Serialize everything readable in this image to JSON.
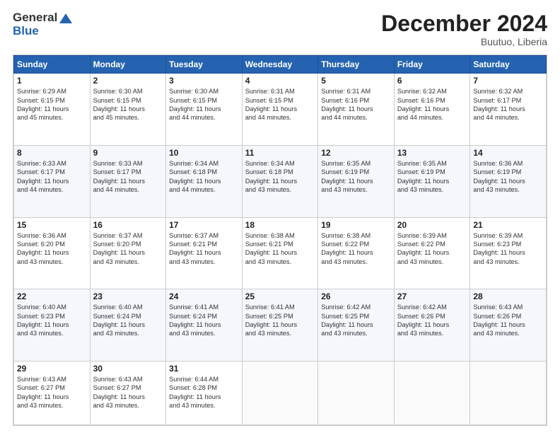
{
  "header": {
    "logo_line1": "General",
    "logo_line2": "Blue",
    "month": "December 2024",
    "location": "Buutuo, Liberia"
  },
  "weekdays": [
    "Sunday",
    "Monday",
    "Tuesday",
    "Wednesday",
    "Thursday",
    "Friday",
    "Saturday"
  ],
  "weeks": [
    [
      {
        "day": "1",
        "sunrise": "6:29 AM",
        "sunset": "6:15 PM",
        "daylight": "11 hours and 45 minutes."
      },
      {
        "day": "2",
        "sunrise": "6:30 AM",
        "sunset": "6:15 PM",
        "daylight": "11 hours and 45 minutes."
      },
      {
        "day": "3",
        "sunrise": "6:30 AM",
        "sunset": "6:15 PM",
        "daylight": "11 hours and 44 minutes."
      },
      {
        "day": "4",
        "sunrise": "6:31 AM",
        "sunset": "6:15 PM",
        "daylight": "11 hours and 44 minutes."
      },
      {
        "day": "5",
        "sunrise": "6:31 AM",
        "sunset": "6:16 PM",
        "daylight": "11 hours and 44 minutes."
      },
      {
        "day": "6",
        "sunrise": "6:32 AM",
        "sunset": "6:16 PM",
        "daylight": "11 hours and 44 minutes."
      },
      {
        "day": "7",
        "sunrise": "6:32 AM",
        "sunset": "6:17 PM",
        "daylight": "11 hours and 44 minutes."
      }
    ],
    [
      {
        "day": "8",
        "sunrise": "6:33 AM",
        "sunset": "6:17 PM",
        "daylight": "11 hours and 44 minutes."
      },
      {
        "day": "9",
        "sunrise": "6:33 AM",
        "sunset": "6:17 PM",
        "daylight": "11 hours and 44 minutes."
      },
      {
        "day": "10",
        "sunrise": "6:34 AM",
        "sunset": "6:18 PM",
        "daylight": "11 hours and 44 minutes."
      },
      {
        "day": "11",
        "sunrise": "6:34 AM",
        "sunset": "6:18 PM",
        "daylight": "11 hours and 43 minutes."
      },
      {
        "day": "12",
        "sunrise": "6:35 AM",
        "sunset": "6:19 PM",
        "daylight": "11 hours and 43 minutes."
      },
      {
        "day": "13",
        "sunrise": "6:35 AM",
        "sunset": "6:19 PM",
        "daylight": "11 hours and 43 minutes."
      },
      {
        "day": "14",
        "sunrise": "6:36 AM",
        "sunset": "6:19 PM",
        "daylight": "11 hours and 43 minutes."
      }
    ],
    [
      {
        "day": "15",
        "sunrise": "6:36 AM",
        "sunset": "6:20 PM",
        "daylight": "11 hours and 43 minutes."
      },
      {
        "day": "16",
        "sunrise": "6:37 AM",
        "sunset": "6:20 PM",
        "daylight": "11 hours and 43 minutes."
      },
      {
        "day": "17",
        "sunrise": "6:37 AM",
        "sunset": "6:21 PM",
        "daylight": "11 hours and 43 minutes."
      },
      {
        "day": "18",
        "sunrise": "6:38 AM",
        "sunset": "6:21 PM",
        "daylight": "11 hours and 43 minutes."
      },
      {
        "day": "19",
        "sunrise": "6:38 AM",
        "sunset": "6:22 PM",
        "daylight": "11 hours and 43 minutes."
      },
      {
        "day": "20",
        "sunrise": "6:39 AM",
        "sunset": "6:22 PM",
        "daylight": "11 hours and 43 minutes."
      },
      {
        "day": "21",
        "sunrise": "6:39 AM",
        "sunset": "6:23 PM",
        "daylight": "11 hours and 43 minutes."
      }
    ],
    [
      {
        "day": "22",
        "sunrise": "6:40 AM",
        "sunset": "6:23 PM",
        "daylight": "11 hours and 43 minutes."
      },
      {
        "day": "23",
        "sunrise": "6:40 AM",
        "sunset": "6:24 PM",
        "daylight": "11 hours and 43 minutes."
      },
      {
        "day": "24",
        "sunrise": "6:41 AM",
        "sunset": "6:24 PM",
        "daylight": "11 hours and 43 minutes."
      },
      {
        "day": "25",
        "sunrise": "6:41 AM",
        "sunset": "6:25 PM",
        "daylight": "11 hours and 43 minutes."
      },
      {
        "day": "26",
        "sunrise": "6:42 AM",
        "sunset": "6:25 PM",
        "daylight": "11 hours and 43 minutes."
      },
      {
        "day": "27",
        "sunrise": "6:42 AM",
        "sunset": "6:26 PM",
        "daylight": "11 hours and 43 minutes."
      },
      {
        "day": "28",
        "sunrise": "6:43 AM",
        "sunset": "6:26 PM",
        "daylight": "11 hours and 43 minutes."
      }
    ],
    [
      {
        "day": "29",
        "sunrise": "6:43 AM",
        "sunset": "6:27 PM",
        "daylight": "11 hours and 43 minutes."
      },
      {
        "day": "30",
        "sunrise": "6:43 AM",
        "sunset": "6:27 PM",
        "daylight": "11 hours and 43 minutes."
      },
      {
        "day": "31",
        "sunrise": "6:44 AM",
        "sunset": "6:28 PM",
        "daylight": "11 hours and 43 minutes."
      },
      null,
      null,
      null,
      null
    ]
  ]
}
